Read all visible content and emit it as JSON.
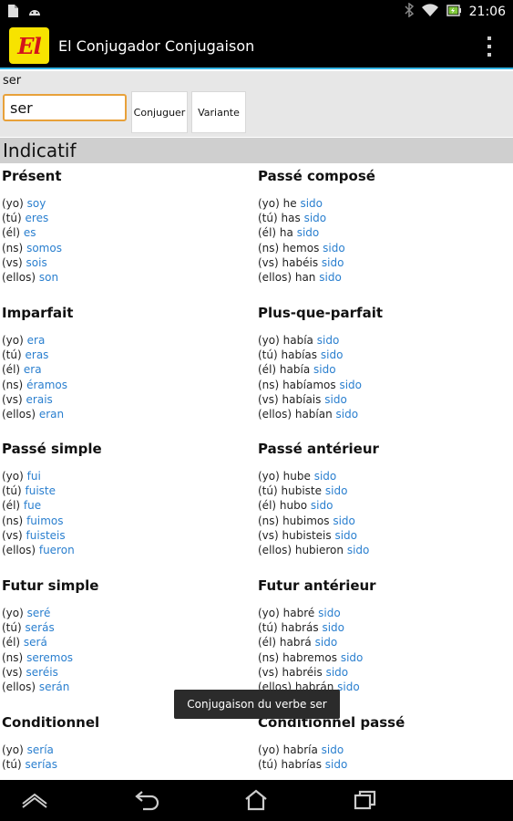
{
  "status_bar": {
    "time": "21:06",
    "icons": [
      "file-icon",
      "android-icon",
      "bluetooth-icon",
      "wifi-icon",
      "battery-charging-icon"
    ]
  },
  "app_bar": {
    "logo_text": "El",
    "title": "El Conjugador Conjugaison",
    "menu_icon": "overflow-menu-icon"
  },
  "search": {
    "label": "ser",
    "value": "ser",
    "conjugate_button": "Conjuguer",
    "variant_button": "Variante"
  },
  "mood": "Indicatif",
  "tenses": [
    {
      "name": "Présent",
      "rows": [
        {
          "pronoun": "(yo)",
          "aux": "",
          "form": "soy"
        },
        {
          "pronoun": "(tú)",
          "aux": "",
          "form": "eres"
        },
        {
          "pronoun": "(él)",
          "aux": "",
          "form": "es"
        },
        {
          "pronoun": "(ns)",
          "aux": "",
          "form": "somos"
        },
        {
          "pronoun": "(vs)",
          "aux": "",
          "form": "sois"
        },
        {
          "pronoun": "(ellos)",
          "aux": "",
          "form": "son"
        }
      ]
    },
    {
      "name": "Passé composé",
      "rows": [
        {
          "pronoun": "(yo)",
          "aux": "he",
          "form": "sido"
        },
        {
          "pronoun": "(tú)",
          "aux": "has",
          "form": "sido"
        },
        {
          "pronoun": "(él)",
          "aux": "ha",
          "form": "sido"
        },
        {
          "pronoun": "(ns)",
          "aux": "hemos",
          "form": "sido"
        },
        {
          "pronoun": "(vs)",
          "aux": "habéis",
          "form": "sido"
        },
        {
          "pronoun": "(ellos)",
          "aux": "han",
          "form": "sido"
        }
      ]
    },
    {
      "name": "Imparfait",
      "rows": [
        {
          "pronoun": "(yo)",
          "aux": "",
          "form": "era"
        },
        {
          "pronoun": "(tú)",
          "aux": "",
          "form": "eras"
        },
        {
          "pronoun": "(él)",
          "aux": "",
          "form": "era"
        },
        {
          "pronoun": "(ns)",
          "aux": "",
          "form": "éramos"
        },
        {
          "pronoun": "(vs)",
          "aux": "",
          "form": "erais"
        },
        {
          "pronoun": "(ellos)",
          "aux": "",
          "form": "eran"
        }
      ]
    },
    {
      "name": "Plus-que-parfait",
      "rows": [
        {
          "pronoun": "(yo)",
          "aux": "había",
          "form": "sido"
        },
        {
          "pronoun": "(tú)",
          "aux": "habías",
          "form": "sido"
        },
        {
          "pronoun": "(él)",
          "aux": "había",
          "form": "sido"
        },
        {
          "pronoun": "(ns)",
          "aux": "habíamos",
          "form": "sido"
        },
        {
          "pronoun": "(vs)",
          "aux": "habíais",
          "form": "sido"
        },
        {
          "pronoun": "(ellos)",
          "aux": "habían",
          "form": "sido"
        }
      ]
    },
    {
      "name": "Passé simple",
      "rows": [
        {
          "pronoun": "(yo)",
          "aux": "",
          "form": "fui"
        },
        {
          "pronoun": "(tú)",
          "aux": "",
          "form": "fuiste"
        },
        {
          "pronoun": "(él)",
          "aux": "",
          "form": "fue"
        },
        {
          "pronoun": "(ns)",
          "aux": "",
          "form": "fuimos"
        },
        {
          "pronoun": "(vs)",
          "aux": "",
          "form": "fuisteis"
        },
        {
          "pronoun": "(ellos)",
          "aux": "",
          "form": "fueron"
        }
      ]
    },
    {
      "name": "Passé antérieur",
      "rows": [
        {
          "pronoun": "(yo)",
          "aux": "hube",
          "form": "sido"
        },
        {
          "pronoun": "(tú)",
          "aux": "hubiste",
          "form": "sido"
        },
        {
          "pronoun": "(él)",
          "aux": "hubo",
          "form": "sido"
        },
        {
          "pronoun": "(ns)",
          "aux": "hubimos",
          "form": "sido"
        },
        {
          "pronoun": "(vs)",
          "aux": "hubisteis",
          "form": "sido"
        },
        {
          "pronoun": "(ellos)",
          "aux": "hubieron",
          "form": "sido"
        }
      ]
    },
    {
      "name": "Futur simple",
      "rows": [
        {
          "pronoun": "(yo)",
          "aux": "",
          "form": "seré"
        },
        {
          "pronoun": "(tú)",
          "aux": "",
          "form": "serás"
        },
        {
          "pronoun": "(él)",
          "aux": "",
          "form": "será"
        },
        {
          "pronoun": "(ns)",
          "aux": "",
          "form": "seremos"
        },
        {
          "pronoun": "(vs)",
          "aux": "",
          "form": "seréis"
        },
        {
          "pronoun": "(ellos)",
          "aux": "",
          "form": "serán"
        }
      ]
    },
    {
      "name": "Futur antérieur",
      "rows": [
        {
          "pronoun": "(yo)",
          "aux": "habré",
          "form": "sido"
        },
        {
          "pronoun": "(tú)",
          "aux": "habrás",
          "form": "sido"
        },
        {
          "pronoun": "(él)",
          "aux": "habrá",
          "form": "sido"
        },
        {
          "pronoun": "(ns)",
          "aux": "habremos",
          "form": "sido"
        },
        {
          "pronoun": "(vs)",
          "aux": "habréis",
          "form": "sido"
        },
        {
          "pronoun": "(ellos)",
          "aux": "habrán",
          "form": "sido"
        }
      ]
    },
    {
      "name": "Conditionnel",
      "rows": [
        {
          "pronoun": "(yo)",
          "aux": "",
          "form": "sería"
        },
        {
          "pronoun": "(tú)",
          "aux": "",
          "form": "serías"
        }
      ]
    },
    {
      "name": "Conditionnel passé",
      "rows": [
        {
          "pronoun": "(yo)",
          "aux": "habría",
          "form": "sido"
        },
        {
          "pronoun": "(tú)",
          "aux": "habrías",
          "form": "sido"
        }
      ]
    }
  ],
  "toast": "Conjugaison du verbe ser",
  "nav_bar": {
    "icons": [
      "home-icon",
      "back-icon",
      "recents-home-icon",
      "recent-apps-icon"
    ]
  },
  "colors": {
    "accent": "#33b5e5",
    "verb_form": "#2a7fcf",
    "input_border": "#e8a13a",
    "header_bg": "#cfcfcf",
    "logo_bg": "#f7e300",
    "logo_text": "#d4141b"
  }
}
